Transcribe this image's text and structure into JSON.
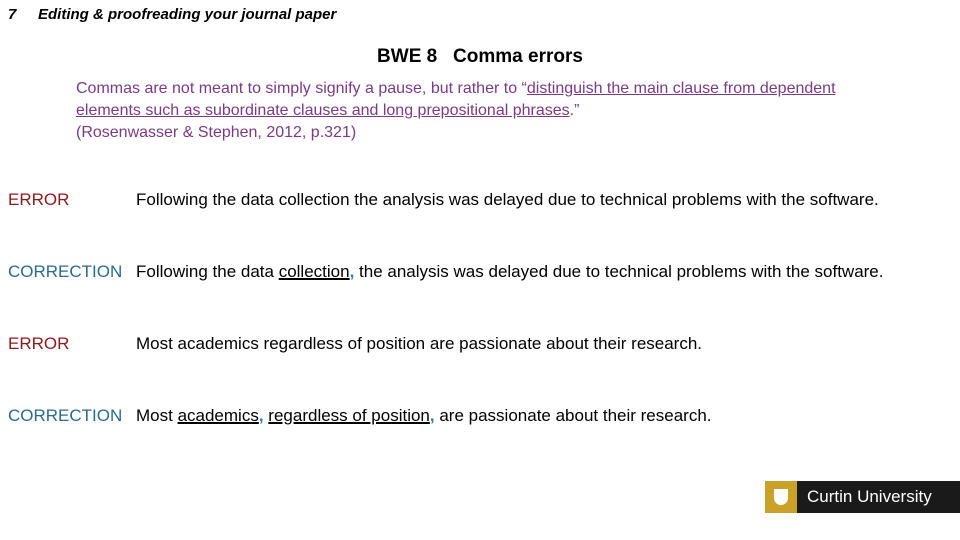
{
  "header": {
    "number": "7",
    "title": "Editing & proofreading your journal paper"
  },
  "slide_title": "BWE 8   Comma errors",
  "quote": {
    "pre": "Commas are not meant to simply signify a pause, but rather to “",
    "underlined": "distinguish the main clause from dependent elements such as subordinate clauses and long prepositional phrases",
    "post": ".”",
    "citation": "(Rosenwasser & Stephen, 2012, p.321)"
  },
  "rows": [
    {
      "label": "ERROR",
      "text": "Following the data collection the analysis was delayed due to technical problems with the software."
    },
    {
      "label": "CORRECTION",
      "p1": "Following the data ",
      "u1": "collection",
      "c1": ",",
      "p2": " the analysis was delayed due to technical problems with the software."
    },
    {
      "label": "ERROR",
      "text": "Most academics regardless of position are passionate about their research."
    },
    {
      "label": "CORRECTION",
      "p1": "Most ",
      "u1": "academics",
      "c1": ",",
      "p2": " ",
      "u2": "regardless of position",
      "c2": ",",
      "p3": " are passionate about their research."
    }
  ],
  "logo": {
    "name": "Curtin University",
    "icon": "shield-icon"
  }
}
